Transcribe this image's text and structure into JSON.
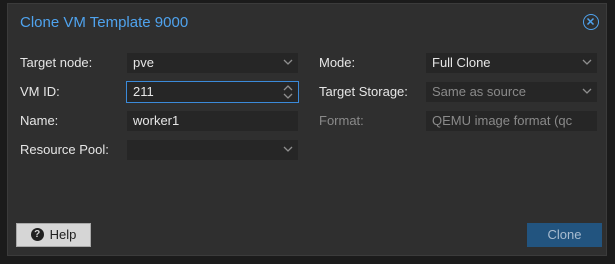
{
  "dialog": {
    "title": "Clone VM Template 9000"
  },
  "fields": {
    "target_node": {
      "label": "Target node:",
      "value": "pve"
    },
    "vm_id": {
      "label": "VM ID:",
      "value": "211"
    },
    "name": {
      "label": "Name:",
      "value": "worker1"
    },
    "resource_pool": {
      "label": "Resource Pool:",
      "value": ""
    },
    "mode": {
      "label": "Mode:",
      "value": "Full Clone"
    },
    "target_storage": {
      "label": "Target Storage:",
      "value": "Same as source"
    },
    "format": {
      "label": "Format:",
      "value": "QEMU image format (qc"
    }
  },
  "footer": {
    "help_label": "Help",
    "clone_label": "Clone"
  },
  "colors": {
    "accent": "#4fa3ee",
    "focus_border": "#3b8ad9",
    "primary_button": "#22547f"
  },
  "icons": {
    "close": "close-circle-icon",
    "help": "question-circle-icon",
    "dropdown": "chevron-down-icon",
    "spinner": "spinner-arrows-icon"
  }
}
